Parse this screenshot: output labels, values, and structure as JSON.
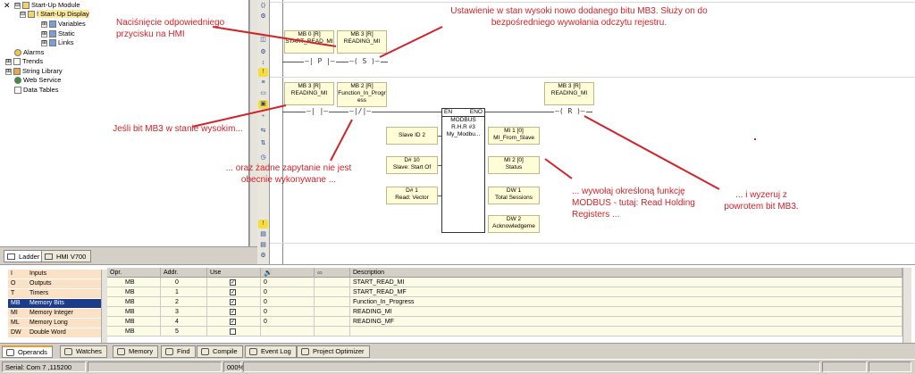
{
  "tree": {
    "items": [
      {
        "label": "Start-Up Module",
        "expander": "⊟",
        "level": 0
      },
      {
        "label": "! Start-Up Display",
        "expander": "⊟",
        "level": 1,
        "selected": true
      },
      {
        "label": "Variables",
        "expander": "⊞",
        "level": 2
      },
      {
        "label": "Static",
        "expander": "⊞",
        "level": 2
      },
      {
        "label": "Links",
        "expander": "⊞",
        "level": 2
      },
      {
        "label": "Alarms",
        "expander": "",
        "level": 0
      },
      {
        "label": "Trends",
        "expander": "⊞",
        "level": 0
      },
      {
        "label": "String Library",
        "expander": "⊞",
        "level": 0
      },
      {
        "label": "Web Service",
        "expander": "",
        "level": 0
      },
      {
        "label": "Data Tables",
        "expander": "",
        "level": 0
      }
    ],
    "tabs": [
      "Ladder",
      "HMI V700"
    ]
  },
  "ladder": {
    "rung1": {
      "contact1": {
        "address": "MB 0 [R]",
        "name": "START_READ_MI",
        "symbol": "—| P |—"
      },
      "coil1": {
        "address": "MB 3 [R]",
        "name": "READING_MI",
        "symbol": "—( S )—"
      }
    },
    "rung2": {
      "contact1": {
        "address": "MB 3 [R]",
        "name": "READING_MI",
        "symbol": "—| |—"
      },
      "contact2": {
        "address": "MB 2 [R]",
        "name": "Function_In_Progress",
        "symbol": "—|/|—"
      },
      "coil": {
        "address": "MB 3 [R]",
        "name": "READING_MI",
        "symbol": "—( R )—"
      },
      "fb": {
        "en": "EN",
        "eno": "ENO",
        "title": "MODBUS",
        "sub": "R.H.R #3",
        "name": "My_Modbu..."
      },
      "inputs": [
        {
          "line1": "Slave ID 2",
          "line2": ""
        },
        {
          "line1": "D# 10",
          "line2": "Slave: Start Of"
        },
        {
          "line1": "D# 1",
          "line2": "Read: Vector"
        }
      ],
      "outputs": [
        {
          "line1": "MI 1 [0]",
          "line2": "MI_From_Slave"
        },
        {
          "line1": "MI 2 [0]",
          "line2": "Status"
        },
        {
          "line1": "DW 1",
          "line2": "Total Sessions"
        },
        {
          "line1": "DW 2",
          "line2": "Acknowledgeme"
        }
      ]
    }
  },
  "annotations": {
    "a1": "Naciśnięcie odpowiedniego przycisku na HMI",
    "a2": "Ustawienie w stan wysoki nowo dodanego bitu MB3. Służy on do bezpośredniego wywołania odczytu rejestru.",
    "a3": "Jeśli bit MB3 w stanie wysokim...",
    "a4": "... oraz żadne zapytanie nie jest obecnie wykonywane ...",
    "a5": "... wywołaj określoną funkcję MODBUS - tutaj: Read Holding Registers ...",
    "a6": "... i wyzeruj z powrotem bit MB3."
  },
  "operands": {
    "categories": [
      {
        "code": "I",
        "label": "Inputs"
      },
      {
        "code": "O",
        "label": "Outputs"
      },
      {
        "code": "T",
        "label": "Timers"
      },
      {
        "code": "MB",
        "label": "Memory Bits",
        "selected": true
      },
      {
        "code": "MI",
        "label": "Memory Integer"
      },
      {
        "code": "ML",
        "label": "Memory Long"
      },
      {
        "code": "DW",
        "label": "Double Word"
      },
      {
        "code": "",
        "label": ""
      }
    ],
    "headers": [
      "Opr.",
      "Addr.",
      "Use",
      "",
      "",
      "Description"
    ],
    "rows": [
      {
        "opr": "MB",
        "addr": "0",
        "use": true,
        "val": "0",
        "desc": "START_READ_MI"
      },
      {
        "opr": "MB",
        "addr": "1",
        "use": true,
        "val": "0",
        "desc": "START_READ_MF"
      },
      {
        "opr": "MB",
        "addr": "2",
        "use": true,
        "val": "0",
        "desc": "Function_In_Progress"
      },
      {
        "opr": "MB",
        "addr": "3",
        "use": true,
        "val": "0",
        "desc": "READING_MI"
      },
      {
        "opr": "MB",
        "addr": "4",
        "use": true,
        "val": "0",
        "desc": "READING_MF"
      },
      {
        "opr": "MB",
        "addr": "5",
        "use": false,
        "val": "",
        "desc": ""
      }
    ]
  },
  "bottom_tabs": [
    "Operands",
    "Watches",
    "Memory",
    "Find",
    "Compile",
    "Event Log",
    "Project Optimizer"
  ],
  "status": {
    "serial": "Serial:  Com 7 ,115200",
    "zoom": "000%"
  }
}
